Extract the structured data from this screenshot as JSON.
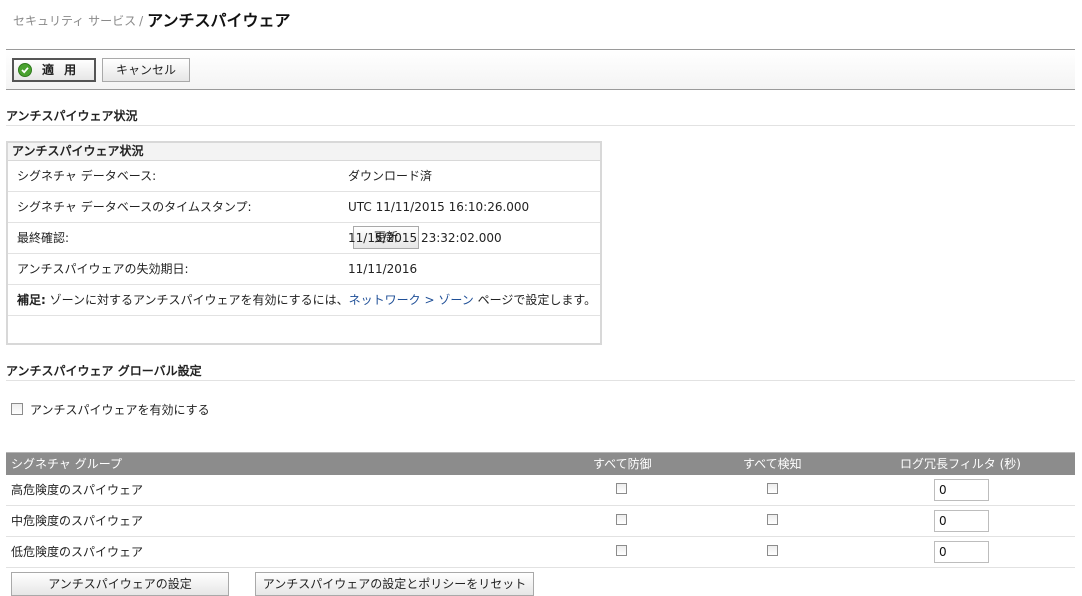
{
  "breadcrumb": {
    "parent": "セキュリティ サービス",
    "separator": "/",
    "title": "アンチスパイウェア"
  },
  "toolbar": {
    "apply_label": "適 用",
    "cancel_label": "キャンセル"
  },
  "status_section": {
    "title": "アンチスパイウェア状況",
    "box_title": "アンチスパイウェア状況",
    "rows": [
      {
        "label": "シグネチャ データベース:",
        "value": "ダウンロード済"
      },
      {
        "label": "シグネチャ データベースのタイムスタンプ:",
        "value": "UTC 11/11/2015 16:10:26.000",
        "button": "更新"
      },
      {
        "label": "最終確認:",
        "value": "11/15/2015 23:32:02.000"
      },
      {
        "label": "アンチスパイウェアの失効期日:",
        "value": "11/11/2016"
      }
    ],
    "note": {
      "prefix": "補足:",
      "text": " ゾーンに対するアンチスパイウェアを有効にするには、",
      "link": "ネットワーク > ゾーン",
      "suffix": " ページで設定します。"
    }
  },
  "global_section": {
    "title": "アンチスパイウェア グローバル設定",
    "enable_label": "アンチスパイウェアを有効にする",
    "enable_checked": false
  },
  "grid": {
    "columns": [
      "シグネチャ グループ",
      "すべて防御",
      "すべて検知",
      "ログ冗長フィルタ (秒)"
    ],
    "rows": [
      {
        "name": "高危険度のスパイウェア",
        "prevent": false,
        "detect": false,
        "log_filter": "0"
      },
      {
        "name": "中危険度のスパイウェア",
        "prevent": false,
        "detect": false,
        "log_filter": "0"
      },
      {
        "name": "低危険度のスパイウェア",
        "prevent": false,
        "detect": false,
        "log_filter": "0"
      }
    ]
  },
  "bottom_buttons": {
    "settings_label": "アンチスパイウェアの設定",
    "reset_label": "アンチスパイウェアの設定とポリシーをリセット"
  },
  "colors": {
    "grid_header_bg": "#8c8c8c",
    "link": "#1f4f97",
    "apply_check": "#4aa22f"
  }
}
